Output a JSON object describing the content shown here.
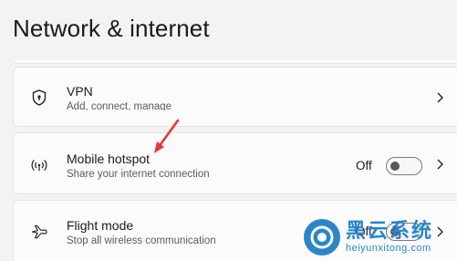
{
  "page": {
    "title": "Network & internet"
  },
  "items": {
    "vpn": {
      "icon": "shield-icon",
      "title": "VPN",
      "subtitle": "Add, connect, manage"
    },
    "hotspot": {
      "icon": "wireless-broadcast-icon",
      "title": "Mobile hotspot",
      "subtitle": "Share your internet connection",
      "toggle_label": "Off",
      "toggle_on": false
    },
    "flight": {
      "icon": "airplane-icon",
      "title": "Flight mode",
      "subtitle": "Stop all wireless communication",
      "toggle_label": "Off",
      "toggle_on": false
    }
  },
  "annotation": {
    "icon": "red-arrow-icon",
    "color": "#e53935"
  },
  "watermark": {
    "brand": "黑云系统",
    "url": "heiyunxitong.com",
    "color": "#2a86c8"
  }
}
